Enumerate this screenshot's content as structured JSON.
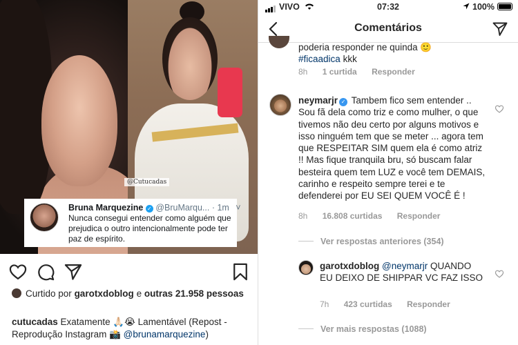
{
  "left": {
    "watermark": "@Cutucadas",
    "tweet": {
      "name": "Bruna Marquezine",
      "handle": "@BruMarqu...",
      "time": "· 1m",
      "chevron": "˅",
      "text": "Nunca consegui entender como alguém que prejudica o outro intencionalmente pode ter paz de espírito."
    },
    "icons": [
      "heart-icon",
      "comment-icon",
      "share-icon",
      "bookmark-icon"
    ],
    "liked": {
      "prefix": "Curtido por",
      "user": "garotxdoblog",
      "connector": "e",
      "others": "outras 21.958 pessoas"
    },
    "caption": {
      "user": "cutucadas",
      "text": "Exatamente 🙏🏻😭 Lamentável (Repost - Reprodução Instagram 📸",
      "mention": "@brunamarquezine",
      "end": ")"
    }
  },
  "right": {
    "status": {
      "carrier": "VIVO",
      "time": "07:32",
      "battery": "100%"
    },
    "nav": {
      "title": "Comentários"
    },
    "prev_comment": {
      "line1": "poderia responder ne quinda 🙂",
      "hashtag": "#ficaadica",
      "rest": "kkk",
      "time": "8h",
      "likes": "1 curtida",
      "reply": "Responder"
    },
    "main_comment": {
      "user": "neymarjr",
      "text": "Tambem fico sem entender .. Sou fã dela como triz e como mulher, o que tivemos não deu certo por alguns motivos e isso ninguém tem que se meter ... agora tem que RESPEITAR SIM quem ela é como atriz !! Mas fique tranquila bru, só buscam falar besteira quem tem LUZ e você tem DEMAIS, carinho e respeito sempre terei e te defenderei por EU SEI QUEM VOCÊ É !",
      "time": "8h",
      "likes": "16.808 curtidas",
      "reply": "Responder"
    },
    "view_previous": "Ver respostas anteriores (354)",
    "reply_comment": {
      "user": "garotxdoblog",
      "mention": "@neymarjr",
      "text": "QUANDO EU DEIXO DE SHIPPAR VC FAZ ISSO",
      "time": "7h",
      "likes": "423 curtidas",
      "reply": "Responder"
    },
    "view_more": "Ver mais respostas (1088)"
  }
}
